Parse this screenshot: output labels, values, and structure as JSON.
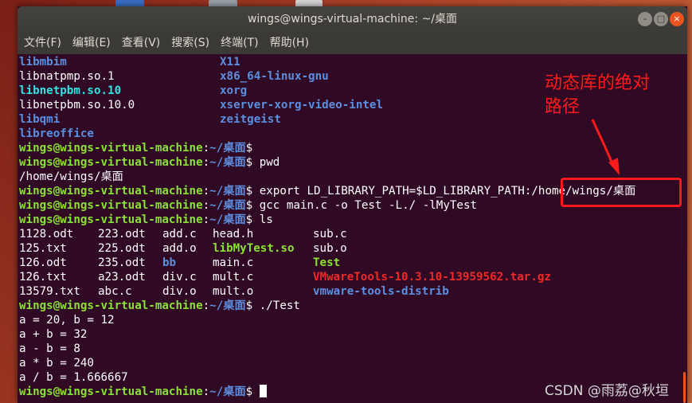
{
  "window": {
    "title": "wings@wings-virtual-machine: ~/桌面",
    "min_glyph": "–",
    "max_glyph": "□",
    "close_glyph": "×"
  },
  "menu": [
    "文件(F)",
    "编辑(E)",
    "查看(V)",
    "搜索(S)",
    "终端(T)",
    "帮助(H)"
  ],
  "colors": {
    "terminal_bg": "#300a24",
    "dir_blue": "#5b8fe0",
    "prompt_green": "#8ae234",
    "archive_red": "#ef2929",
    "annotation_red": "#ff1a1a"
  },
  "terminal": {
    "listing_top": [
      [
        "libmbim",
        "X11"
      ],
      [
        "libnatpmp.so.1",
        "x86_64-linux-gnu"
      ],
      [
        "libnetpbm.so.10",
        "xorg"
      ],
      [
        "libnetpbm.so.10.0",
        "xserver-xorg-video-intel"
      ],
      [
        "libqmi",
        "zeitgeist"
      ],
      [
        "libreoffice",
        ""
      ]
    ],
    "prompt_user": "wings@wings-virtual-machine",
    "prompt_sep": ":",
    "prompt_path": "~/桌面",
    "prompt_end": "$",
    "cmd_pwd": " pwd",
    "out_pwd": "/home/wings/桌面",
    "cmd_export": " export LD_LIBRARY_PATH=$LD_LIBRARY_PATH:/home/wings/桌面",
    "cmd_gcc": " gcc main.c -o Test -L./ -lMyTest",
    "cmd_ls": " ls",
    "ls_rows": [
      [
        "1128.odt",
        "223.odt",
        "add.c",
        "head.h",
        "",
        "sub.c"
      ],
      [
        "125.txt",
        "225.odt",
        "add.o",
        "libMyTest.so",
        "",
        "sub.o"
      ],
      [
        "126.odt",
        "235.odt",
        "bb",
        "main.c",
        "",
        "Test"
      ],
      [
        "126.txt",
        "a23.odt",
        "div.c",
        "mult.c",
        "",
        "VMwareTools-10.3.10-13959562.tar.gz"
      ],
      [
        "13579.txt",
        "abc.c",
        "div.o",
        "mult.o",
        "",
        "vmware-tools-distrib"
      ]
    ],
    "cmd_run": " ./Test",
    "run_output": [
      "a = 20, b = 12",
      "a + b = 32",
      "a - b = 8",
      "a * b = 240",
      "a / b = 1.666667"
    ]
  },
  "annotation": {
    "text": "动态库的绝对路径"
  },
  "watermark": "CSDN @雨荔@秋垣"
}
